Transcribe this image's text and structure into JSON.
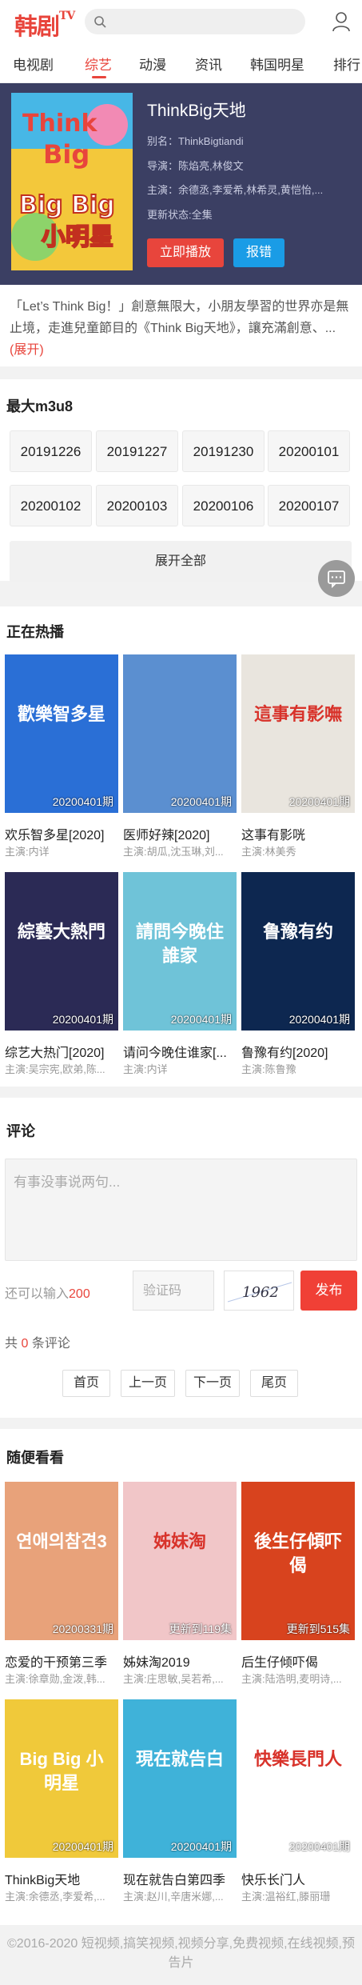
{
  "header": {
    "logo": "韩剧",
    "logo_sup": "TV",
    "search_placeholder": ""
  },
  "nav": [
    "电视剧",
    "综艺",
    "动漫",
    "资讯",
    "韩国明星",
    "排行"
  ],
  "hero": {
    "title": "ThinkBig天地",
    "alias": "别名：ThinkBigtiandi",
    "director": "导演：陈焰亮,林俊文",
    "cast": "主演：余德丞,李爱希,林希灵,黄恺怡,...",
    "status": "更新状态:全集",
    "play": "立即播放",
    "report": "报错",
    "poster_text": [
      "Think",
      "Big",
      "Big Big",
      "小明星"
    ]
  },
  "desc": {
    "text": "「Let’s Think Big！」創意無限大，小朋友學習的世界亦是無止境，走進兒童節目的《Think Big天地》，讓充滿創意、...",
    "more": "(展开)"
  },
  "m3u8": {
    "title": "最大m3u8",
    "eps": [
      "20191226",
      "20191227",
      "20191230",
      "20200101",
      "20200102",
      "20200103",
      "20200106",
      "20200107"
    ],
    "show_all": "展开全部"
  },
  "hot": {
    "title": "正在热播",
    "items": [
      {
        "title": "欢乐智多星[2020]",
        "sub": "主演:内详",
        "badge": "20200401期",
        "bg": "#2a6fd6",
        "img_text": "歡樂智多星"
      },
      {
        "title": "医师好辣[2020]",
        "sub": "主演:胡瓜,沈玉琳,刘...",
        "badge": "20200401期",
        "bg": "#5b8fd0",
        "img_text": ""
      },
      {
        "title": "这事有影咣",
        "sub": "主演:林美秀",
        "badge": "20200401期",
        "bg": "#e9e5de",
        "img_text": "這事有影嘸"
      },
      {
        "title": "综艺大热门[2020]",
        "sub": "主演:吴宗宪,欧弟,陈...",
        "badge": "20200401期",
        "bg": "#2b2a55",
        "img_text": "綜藝大熱門"
      },
      {
        "title": "请问今晚住谁家[...",
        "sub": "主演:内详",
        "badge": "20200401期",
        "bg": "#6fc3d8",
        "img_text": "請問今晚住誰家"
      },
      {
        "title": "鲁豫有约[2020]",
        "sub": "主演:陈鲁豫",
        "badge": "20200401期",
        "bg": "#0d2750",
        "img_text": "鲁豫有约"
      }
    ]
  },
  "comment": {
    "title": "评论",
    "placeholder": "有事没事说两句...",
    "left_prefix": "还可以输入",
    "left_num": "200",
    "code_placeholder": "验证码",
    "code_img": "1962",
    "publish": "发布",
    "count_prefix": "共",
    "count": "0",
    "count_suffix": "条评论",
    "pager": [
      "首页",
      "上一页",
      "下一页",
      "尾页"
    ]
  },
  "random": {
    "title": "随便看看",
    "items": [
      {
        "title": "恋爱的干预第三季",
        "sub": "主演:徐章勋,金泼,韩...",
        "badge": "20200331期",
        "bg": "#e8a27a",
        "img_text": "연애의참견3"
      },
      {
        "title": "姊妹淘2019",
        "sub": "主演:庄思敏,吴若希,...",
        "badge": "更新到119集",
        "bg": "#f1c6c8",
        "img_text": "姊妹淘"
      },
      {
        "title": "后生仔倾吓偈",
        "sub": "主演:陆浩明,麦明诗,...",
        "badge": "更新到515集",
        "bg": "#d8431e",
        "img_text": "後生仔傾吓偈"
      },
      {
        "title": "ThinkBig天地",
        "sub": "主演:余德丞,李爱希,...",
        "badge": "20200401期",
        "bg": "#f0c93a",
        "img_text": "Big Big 小明星"
      },
      {
        "title": "现在就告白第四季",
        "sub": "主演:赵川,辛唐米娜,...",
        "badge": "20200401期",
        "bg": "#3fb2d9",
        "img_text": "現在就告白"
      },
      {
        "title": "快乐长门人",
        "sub": "主演:温裕红,滕丽珊",
        "badge": "20200401期",
        "bg": "#ffffff",
        "img_text": "快樂長門人"
      }
    ]
  },
  "footer": "©2016-2020 短视频,搞笑视频,视频分享,免费视频,在线视频,预告片"
}
